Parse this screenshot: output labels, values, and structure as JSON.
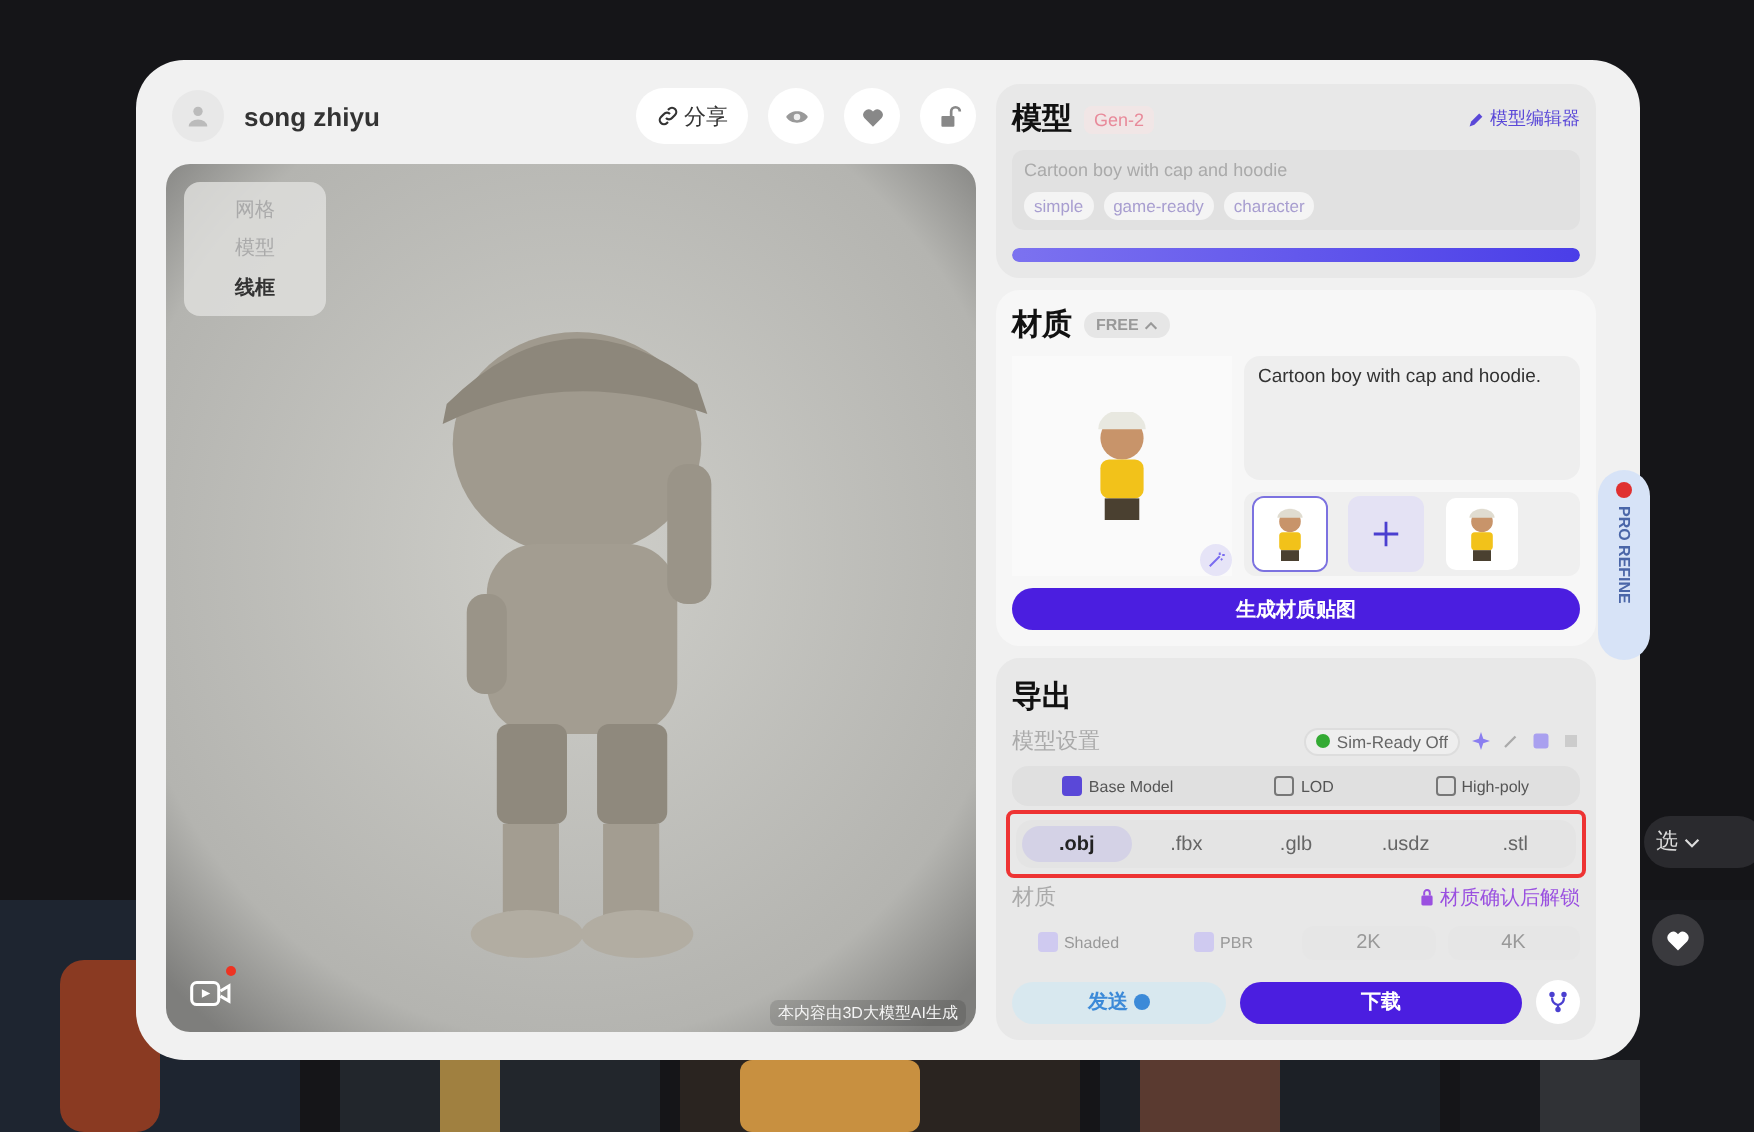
{
  "background": {
    "filter": "选"
  },
  "user": {
    "name": "song zhiyu"
  },
  "header_actions": [
    {
      "kind": "share",
      "label": "分享"
    },
    {
      "kind": "view"
    },
    {
      "kind": "like"
    },
    {
      "kind": "lock"
    }
  ],
  "viewer": {
    "menu": [
      {
        "label": "网格",
        "selected": false
      },
      {
        "label": "模型",
        "selected": false
      },
      {
        "label": "线框",
        "selected": true
      }
    ],
    "recording": true,
    "disclaimer": "本内容由3D大模型AI生成"
  },
  "model": {
    "title": "模型",
    "badge": "Gen-2",
    "editor_link": "模型编辑器",
    "prompt": "Cartoon boy with cap and hoodie",
    "tags": [
      "simple",
      "game-ready",
      "character"
    ],
    "level": 1
  },
  "material": {
    "title": "材质",
    "badge": "FREE",
    "prompt": "Cartoon boy with cap and hoodie.",
    "references": [
      {
        "kind": "picture",
        "selected": true
      },
      {
        "kind": "add",
        "selected": false
      },
      {
        "kind": "picture",
        "selected": false
      }
    ],
    "generate": "生成材质贴图"
  },
  "pro_refine": "PRO REFINE",
  "export": {
    "title": "导出",
    "settings_label": "模型设置",
    "sim_ready": "Sim-Ready Off",
    "options": [
      {
        "label": "Base Model",
        "checked": true
      },
      {
        "label": "LOD",
        "checked": false
      },
      {
        "label": "High-poly",
        "checked": false
      }
    ],
    "formats_highlighted": true,
    "formats": [
      {
        "label": ".obj",
        "selected": true
      },
      {
        "label": ".fbx",
        "selected": false
      },
      {
        "label": ".glb",
        "selected": false
      },
      {
        "label": ".usdz",
        "selected": false
      },
      {
        "label": ".stl",
        "selected": false
      }
    ],
    "material_label": "材质",
    "unlock": "材质确认后解锁",
    "material_options": [
      {
        "label": "Shaded",
        "checked": true
      },
      {
        "label": "PBR",
        "checked": true
      }
    ],
    "resolutions": [
      {
        "label": "2K",
        "selected": false
      },
      {
        "label": "4K",
        "selected": false
      }
    ],
    "send": "发送",
    "download": "下载"
  }
}
